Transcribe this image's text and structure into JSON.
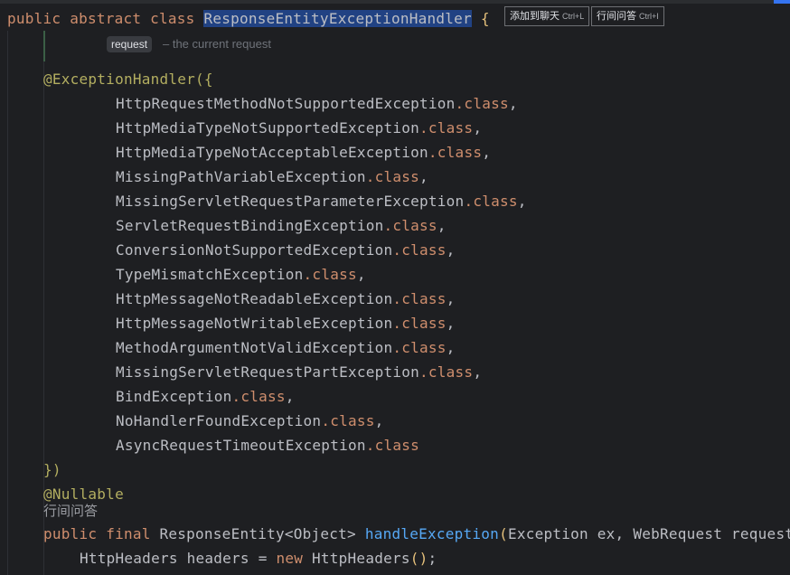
{
  "class_decl": {
    "kw_public": "public",
    "kw_abstract": "abstract",
    "kw_class": "class",
    "class_name": "ResponseEntityExceptionHandler",
    "brace": "{"
  },
  "ai_buttons": {
    "add_to_chat_label": "添加到聊天",
    "add_to_chat_shortcut": "Ctrl+L",
    "inline_ask_label": "行间问答",
    "inline_ask_shortcut": "Ctrl+I"
  },
  "javadoc": {
    "param_name": "request",
    "param_desc": "– the current request"
  },
  "annotation": {
    "open": "@ExceptionHandler({",
    "close": "})"
  },
  "exceptions": [
    {
      "name": "HttpRequestMethodNotSupportedException",
      "suffix": ".class",
      "comma": ","
    },
    {
      "name": "HttpMediaTypeNotSupportedException",
      "suffix": ".class",
      "comma": ","
    },
    {
      "name": "HttpMediaTypeNotAcceptableException",
      "suffix": ".class",
      "comma": ","
    },
    {
      "name": "MissingPathVariableException",
      "suffix": ".class",
      "comma": ","
    },
    {
      "name": "MissingServletRequestParameterException",
      "suffix": ".class",
      "comma": ","
    },
    {
      "name": "ServletRequestBindingException",
      "suffix": ".class",
      "comma": ","
    },
    {
      "name": "ConversionNotSupportedException",
      "suffix": ".class",
      "comma": ","
    },
    {
      "name": "TypeMismatchException",
      "suffix": ".class",
      "comma": ","
    },
    {
      "name": "HttpMessageNotReadableException",
      "suffix": ".class",
      "comma": ","
    },
    {
      "name": "HttpMessageNotWritableException",
      "suffix": ".class",
      "comma": ","
    },
    {
      "name": "MethodArgumentNotValidException",
      "suffix": ".class",
      "comma": ","
    },
    {
      "name": "MissingServletRequestPartException",
      "suffix": ".class",
      "comma": ","
    },
    {
      "name": "BindException",
      "suffix": ".class",
      "comma": ","
    },
    {
      "name": "NoHandlerFoundException",
      "suffix": ".class",
      "comma": ","
    },
    {
      "name": "AsyncRequestTimeoutException",
      "suffix": ".class",
      "comma": ""
    }
  ],
  "nullable": "@Nullable",
  "inlay_hint": "行间问答",
  "method": {
    "kw_public": "public",
    "kw_final": "final",
    "return_type": "ResponseEntity",
    "generic": "<Object>",
    "name": "handleException",
    "open_paren": "(",
    "params": "Exception ex, WebRequest request"
  },
  "body_line": {
    "type": "HttpHeaders",
    "var": "headers",
    "eq": "=",
    "kw_new": "new",
    "ctor": "HttpHeaders",
    "parens": "()",
    "semi": ";"
  },
  "colors": {
    "background": "#1e1f22",
    "keyword": "#cf8e6d",
    "annotation": "#b3ae60",
    "method_name": "#56a8f5",
    "text": "#bcbec4",
    "selection": "#214283"
  }
}
